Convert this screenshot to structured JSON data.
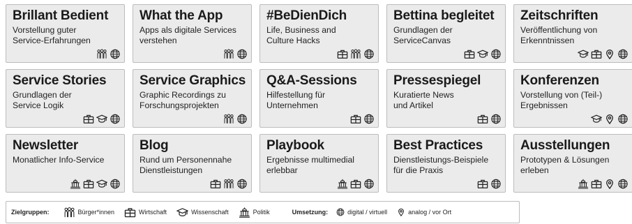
{
  "cards": [
    {
      "title": "Brillant Bedient",
      "desc": "Vorstellung guter\nService-Erfahrungen",
      "icons": [
        "people",
        "globe"
      ]
    },
    {
      "title": "What the App",
      "desc": "Apps als digitale Services\nverstehen",
      "icons": [
        "people",
        "globe"
      ]
    },
    {
      "title": "#BeDienDich",
      "desc": "Life, Business and\nCulture Hacks",
      "icons": [
        "briefcase",
        "people",
        "globe"
      ]
    },
    {
      "title": "Bettina begleitet",
      "desc": "Grundlagen der\nServiceCanvas",
      "icons": [
        "briefcase",
        "graduation",
        "globe"
      ]
    },
    {
      "title": "Zeitschriften",
      "desc": "Veröffentlichung von\nErkenntnissen",
      "icons": [
        "graduation",
        "briefcase",
        "pin",
        "globe"
      ]
    },
    {
      "title": "Service Stories",
      "desc": "Grundlagen der\nService Logik",
      "icons": [
        "briefcase",
        "graduation",
        "globe"
      ]
    },
    {
      "title": "Service Graphics",
      "desc": "Graphic Recordings zu\nForschungsprojekten",
      "icons": [
        "people",
        "globe"
      ]
    },
    {
      "title": "Q&A-Sessions",
      "desc": "Hilfestellung für\nUnternehmen",
      "icons": [
        "briefcase",
        "globe"
      ]
    },
    {
      "title": "Pressespiegel",
      "desc": "Kuratierte News\nund Artikel",
      "icons": [
        "briefcase",
        "globe"
      ]
    },
    {
      "title": "Konferenzen",
      "desc": "Vorstellung von (Teil-)\nErgebnissen",
      "icons": [
        "graduation",
        "pin",
        "globe"
      ]
    },
    {
      "title": "Newsletter",
      "desc": "Monatlicher Info-Service",
      "icons": [
        "capitol",
        "briefcase",
        "graduation",
        "globe"
      ]
    },
    {
      "title": "Blog",
      "desc": "Rund um Personennahe\nDienstleistungen",
      "icons": [
        "briefcase",
        "people",
        "globe"
      ]
    },
    {
      "title": "Playbook",
      "desc": "Ergebnisse multimedial\nerlebbar",
      "icons": [
        "capitol",
        "briefcase",
        "globe"
      ]
    },
    {
      "title": "Best Practices",
      "desc": "Dienstleistungs-Beispiele\nfür die Praxis",
      "icons": [
        "briefcase",
        "globe"
      ]
    },
    {
      "title": "Ausstellungen",
      "desc": "Prototypen & Lösungen\nerleben",
      "icons": [
        "capitol",
        "briefcase",
        "pin",
        "globe"
      ]
    }
  ],
  "legend": {
    "zielgruppen_label": "Zielgruppen:",
    "umsetzung_label": "Umsetzung:",
    "items": {
      "people": "Bürger*innen",
      "briefcase": "Wirtschaft",
      "graduation": "Wissenschaft",
      "capitol": "Politik",
      "globe": "digital / virtuell",
      "pin": "analog / vor Ort"
    }
  },
  "colors": {
    "card_bg": "#ebebeb",
    "card_border": "#bcbcbc",
    "text": "#1a1a1a",
    "icon": "#222222"
  }
}
